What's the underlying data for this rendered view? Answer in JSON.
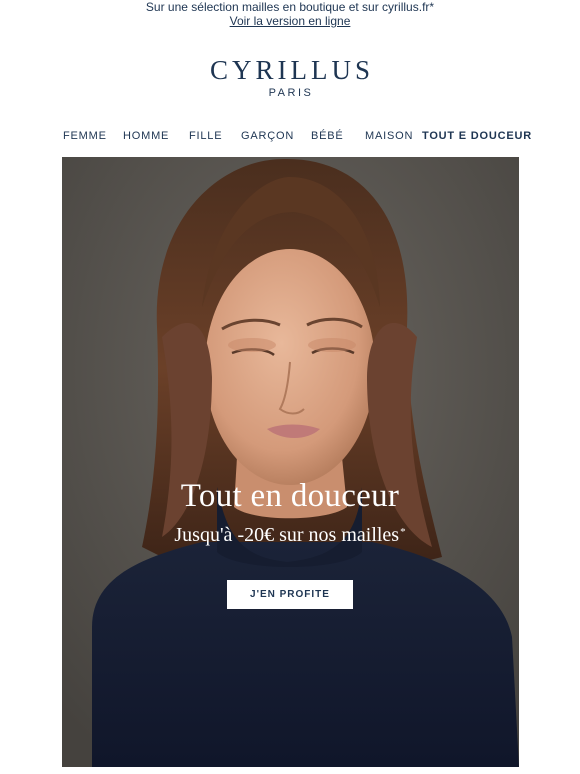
{
  "preheader": {
    "text": "Sur une sélection mailles en boutique et sur cyrillus.fr*",
    "link": "Voir la version en ligne"
  },
  "logo": {
    "brand": "CYRILLUS",
    "city": "PARIS"
  },
  "nav": {
    "items": [
      {
        "label": "FEMME"
      },
      {
        "label": "HOMME"
      },
      {
        "label": "FILLE"
      },
      {
        "label": "GARÇON"
      },
      {
        "label": "BÉBÉ"
      },
      {
        "label": "MAISON"
      },
      {
        "label": "TOUT E DOUCEUR"
      }
    ]
  },
  "hero": {
    "title": "Tout en douceur",
    "subtitle": "Jusqu'à -20€ sur nos mailles",
    "asterisk": "*",
    "cta": "J'EN PROFITE"
  },
  "colors": {
    "text": "#1e3552",
    "background": "#ffffff",
    "hero_background": "#5a5651",
    "sweater": "#141b2d"
  }
}
